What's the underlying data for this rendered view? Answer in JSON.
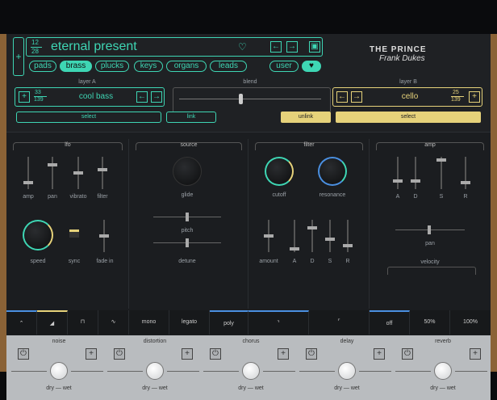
{
  "preset": {
    "index": "12",
    "total": "28",
    "name": "eternal present"
  },
  "categories": [
    {
      "label": "pads",
      "active": false
    },
    {
      "label": "brass",
      "active": true
    },
    {
      "label": "plucks",
      "active": false
    },
    {
      "label": "keys",
      "active": false
    },
    {
      "label": "organs",
      "active": false
    },
    {
      "label": "leads",
      "active": false
    }
  ],
  "user_label": "user",
  "brand": {
    "line1": "THE PRINCE",
    "line2": "Frank Dukes"
  },
  "layerA": {
    "title": "layer A",
    "index": "33",
    "total": "139",
    "name": "cool bass",
    "select": "select",
    "link": "link"
  },
  "blend": {
    "title": "blend",
    "value": 0.5
  },
  "layerB": {
    "title": "layer B",
    "index": "25",
    "total": "139",
    "name": "cello",
    "select": "select",
    "unlink": "unlink"
  },
  "sections": {
    "lfo": {
      "title": "lfo",
      "sliders": [
        "amp",
        "pan",
        "vibrato",
        "filter"
      ],
      "knobs": [
        "speed",
        "sync",
        "fade in"
      ]
    },
    "source": {
      "title": "source",
      "knob": "glide",
      "sliders": [
        "pitch",
        "detune"
      ]
    },
    "filter": {
      "title": "filter",
      "knobs": [
        "cutoff",
        "resonance"
      ],
      "sliders": [
        "amount",
        "A",
        "D",
        "S",
        "R"
      ]
    },
    "amp": {
      "title": "amp",
      "sliders": [
        "A",
        "D",
        "S",
        "R"
      ],
      "pan": "pan",
      "velocity": "velocity"
    }
  },
  "mode_buttons": [
    "mono",
    "legato",
    "poly"
  ],
  "velocity_buttons": [
    "off",
    "50%",
    "100%"
  ],
  "fx": [
    {
      "title": "noise",
      "label": "dry — wet"
    },
    {
      "title": "distortion",
      "label": "dry — wet"
    },
    {
      "title": "chorus",
      "label": "dry — wet"
    },
    {
      "title": "delay",
      "label": "dry — wet"
    },
    {
      "title": "reverb",
      "label": "dry — wet"
    }
  ],
  "colors": {
    "accent_green": "#3ed6b4",
    "accent_yellow": "#e6d27a",
    "accent_blue": "#4a8fe0"
  }
}
